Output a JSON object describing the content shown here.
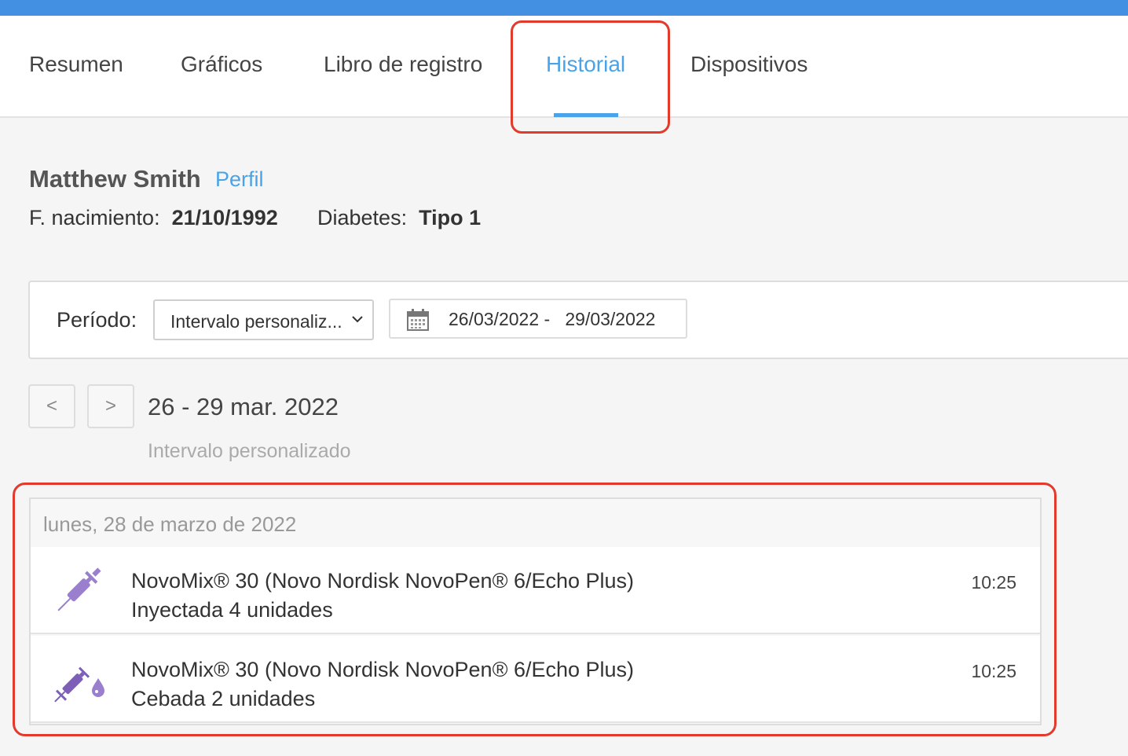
{
  "tabs": [
    {
      "label": "Resumen"
    },
    {
      "label": "Gráficos"
    },
    {
      "label": "Libro de registro"
    },
    {
      "label": "Historial"
    },
    {
      "label": "Dispositivos"
    }
  ],
  "active_tab": "Historial",
  "patient": {
    "name": "Matthew Smith",
    "profile_link": "Perfil",
    "birth_label": "F. nacimiento:",
    "birth_value": "21/10/1992",
    "diabetes_label": "Diabetes:",
    "diabetes_value": "Tipo 1"
  },
  "period": {
    "label": "Período:",
    "selected": "Intervalo personaliz...",
    "date_start": "26/03/2022",
    "date_separator": "-",
    "date_end": "29/03/2022"
  },
  "range": {
    "prev": "<",
    "next": ">",
    "title": "26 - 29 mar. 2022",
    "subtitle": "Intervalo personalizado"
  },
  "day": {
    "header": "lunes, 28 de marzo de 2022",
    "entries": [
      {
        "icon": "syringe-icon",
        "title": "NovoMix® 30 (Novo Nordisk NovoPen® 6/Echo Plus)",
        "detail": "Inyectada 4 unidades",
        "time": "10:25"
      },
      {
        "icon": "syringe-drop-icon",
        "title": "NovoMix® 30 (Novo Nordisk NovoPen® 6/Echo Plus)",
        "detail": "Cebada 2 unidades",
        "time": "10:25"
      }
    ]
  },
  "colors": {
    "accent": "#4aa3e8",
    "topbar": "#4390e2",
    "highlight": "#e23a2c",
    "insulin_icon": "#9b7fcf"
  }
}
